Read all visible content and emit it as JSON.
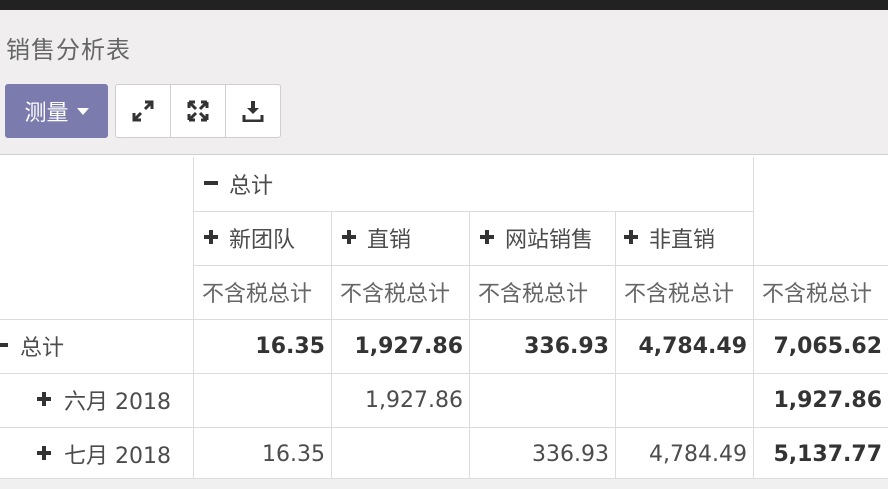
{
  "page_title": "销售分析表",
  "toolbar": {
    "measure_label": "测量",
    "icons": [
      "expand-icon",
      "flip-axis-icon",
      "download-icon"
    ]
  },
  "pivot": {
    "col_header_total": "总计",
    "col_groups": [
      "新团队",
      "直销",
      "网站销售",
      "非直销"
    ],
    "measure_label": "不含税总计",
    "rows": [
      {
        "label": "总计",
        "toggle": "minus",
        "values": [
          "16.35",
          "1,927.86",
          "336.93",
          "4,784.49"
        ],
        "total": "7,065.62"
      },
      {
        "label": "六月 2018",
        "toggle": "plus",
        "values": [
          "",
          "1,927.86",
          "",
          ""
        ],
        "total": "1,927.86"
      },
      {
        "label": "七月 2018",
        "toggle": "plus",
        "values": [
          "16.35",
          "",
          "336.93",
          "4,784.49"
        ],
        "total": "5,137.77"
      }
    ]
  },
  "colors": {
    "accent": "#7c7bad",
    "topbar": "#222222"
  }
}
